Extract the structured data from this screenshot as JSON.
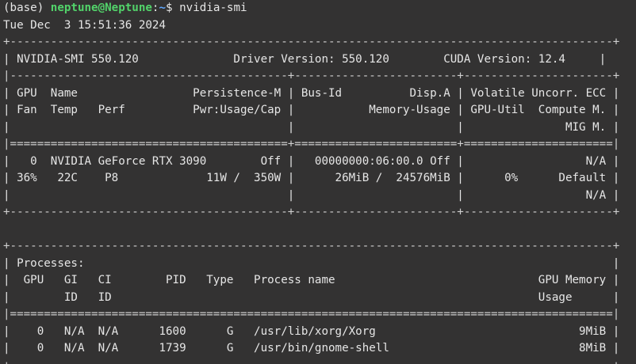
{
  "window": {
    "prompt_env": "(base) ",
    "prompt_user": "neptune@Neptune",
    "prompt_sep": ":",
    "prompt_path": "~",
    "prompt_symbol": "$ ",
    "command": "nvidia-smi"
  },
  "output_lines": [
    "Tue Dec  3 15:51:36 2024",
    "+-----------------------------------------------------------------------------------------+",
    "| NVIDIA-SMI 550.120              Driver Version: 550.120        CUDA Version: 12.4     |",
    "|-----------------------------------------+------------------------+----------------------+",
    "| GPU  Name                 Persistence-M | Bus-Id          Disp.A | Volatile Uncorr. ECC |",
    "| Fan  Temp   Perf          Pwr:Usage/Cap |           Memory-Usage | GPU-Util  Compute M. |",
    "|                                         |                        |               MIG M. |",
    "|=========================================+========================+======================|",
    "|   0  NVIDIA GeForce RTX 3090        Off |   00000000:06:00.0 Off |                  N/A |",
    "| 36%   22C    P8             11W /  350W |      26MiB /  24576MiB |      0%      Default |",
    "|                                         |                        |                  N/A |",
    "+-----------------------------------------+------------------------+----------------------+",
    "",
    "+-----------------------------------------------------------------------------------------+",
    "| Processes:                                                                              |",
    "|  GPU   GI   CI        PID   Type   Process name                              GPU Memory |",
    "|        ID   ID                                                               Usage      |",
    "|=========================================================================================|",
    "|    0   N/A  N/A      1600      G   /usr/lib/xorg/Xorg                              9MiB |",
    "|    0   N/A  N/A      1739      G   /usr/bin/gnome-shell                            8MiB |",
    "+-----------------------------------------------------------------------------------------+"
  ],
  "colors": {
    "background": "#333232",
    "text": "#e6e6e6",
    "user": "#52d36a",
    "path": "#5fa8ff"
  }
}
